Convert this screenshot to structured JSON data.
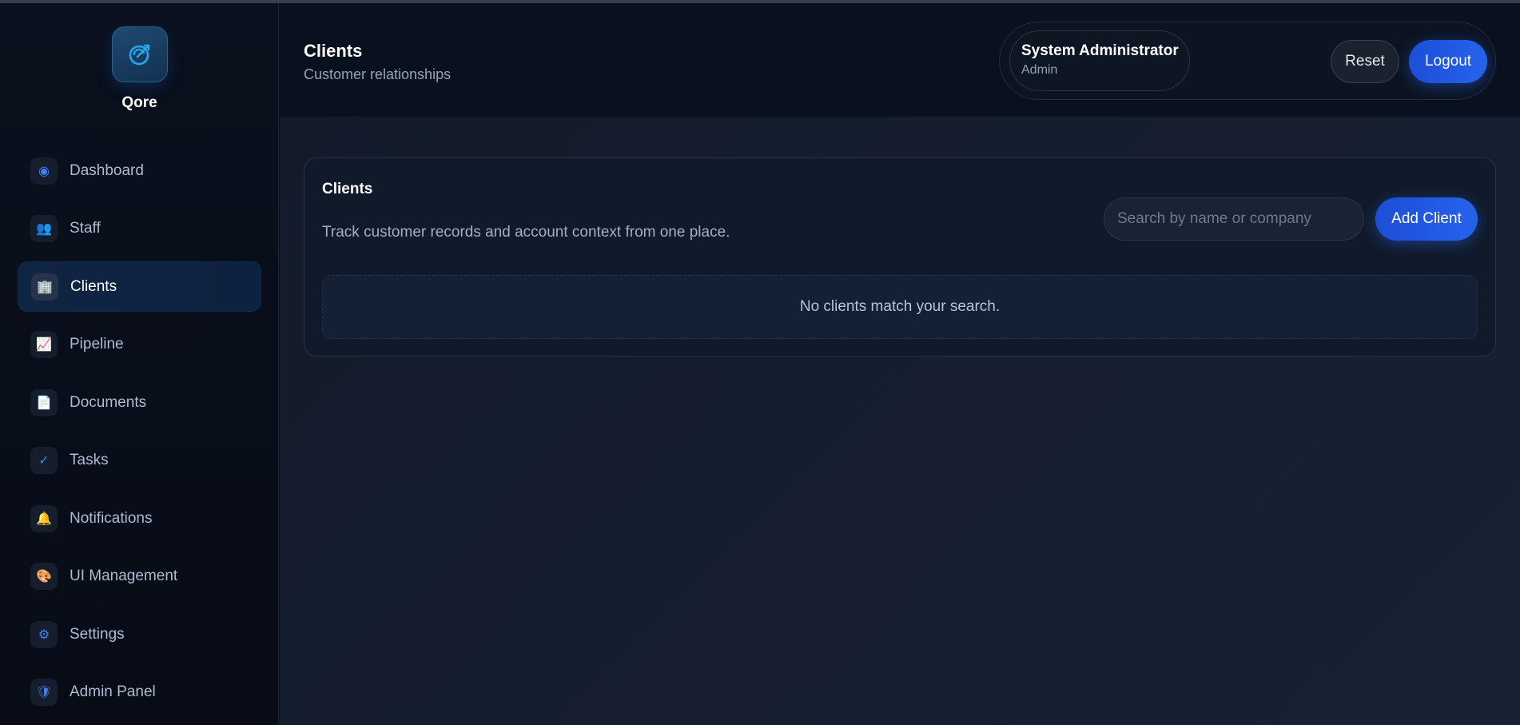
{
  "app": {
    "brand": "Qore"
  },
  "sidebar": {
    "items": [
      {
        "label": "Dashboard",
        "icon": "◉"
      },
      {
        "label": "Staff",
        "icon": "👥"
      },
      {
        "label": "Clients",
        "icon": "🏢",
        "active": true
      },
      {
        "label": "Pipeline",
        "icon": "📈"
      },
      {
        "label": "Documents",
        "icon": "📄"
      },
      {
        "label": "Tasks",
        "icon": "✓"
      },
      {
        "label": "Notifications",
        "icon": "🔔"
      },
      {
        "label": "UI Management",
        "icon": "🎨"
      },
      {
        "label": "Settings",
        "icon": "⚙"
      },
      {
        "label": "Admin Panel",
        "icon": "🛡"
      }
    ]
  },
  "header": {
    "title": "Clients",
    "subtitle": "Customer relationships",
    "user": {
      "name": "System Administrator",
      "role": "Admin"
    },
    "reset_label": "Reset",
    "logout_label": "Logout"
  },
  "main": {
    "card_title": "Clients",
    "card_description": "Track customer records and account context from one place.",
    "search": {
      "placeholder": "Search by name or company",
      "value": ""
    },
    "add_label": "Add Client",
    "empty_message": "No clients match your search."
  },
  "colors": {
    "accent": "#2563eb",
    "background": "#0b1120"
  }
}
